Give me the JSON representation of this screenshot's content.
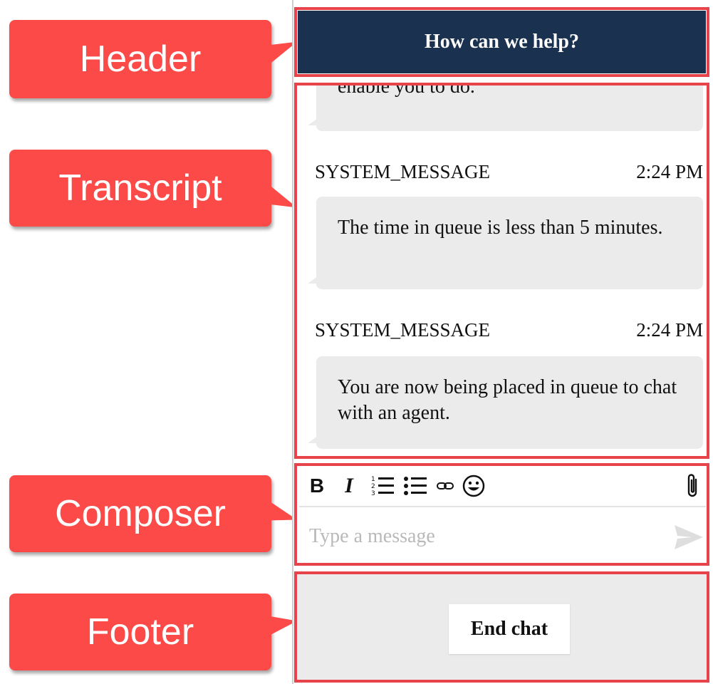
{
  "callouts": {
    "header": "Header",
    "transcript": "Transcript",
    "composer": "Composer",
    "footer": "Footer"
  },
  "header": {
    "title": "How can we help?"
  },
  "transcript": {
    "messages": [
      {
        "sender": "",
        "time": "",
        "text": "enable you to do."
      },
      {
        "sender": "SYSTEM_MESSAGE",
        "time": "2:24 PM",
        "text": "The time in queue is less than 5 minutes."
      },
      {
        "sender": "SYSTEM_MESSAGE",
        "time": "2:24 PM",
        "text": "You are now being placed in queue to chat with an agent."
      }
    ]
  },
  "composer": {
    "toolbar": {
      "bold_icon": "bold-icon",
      "italic_icon": "italic-icon",
      "numbered_list_icon": "numbered-list-icon",
      "bulleted_list_icon": "bulleted-list-icon",
      "link_icon": "link-icon",
      "emoji_icon": "emoji-icon",
      "attach_icon": "paperclip-icon"
    },
    "input": {
      "placeholder": "Type a message",
      "value": ""
    },
    "send_icon": "send-icon"
  },
  "footer": {
    "end_chat_label": "End chat"
  },
  "colors": {
    "callout": "#fc4a48",
    "frame": "#e8434a",
    "header_bg": "#1b3150",
    "bubble_bg": "#ebebeb",
    "footer_bg": "#ebebeb"
  }
}
